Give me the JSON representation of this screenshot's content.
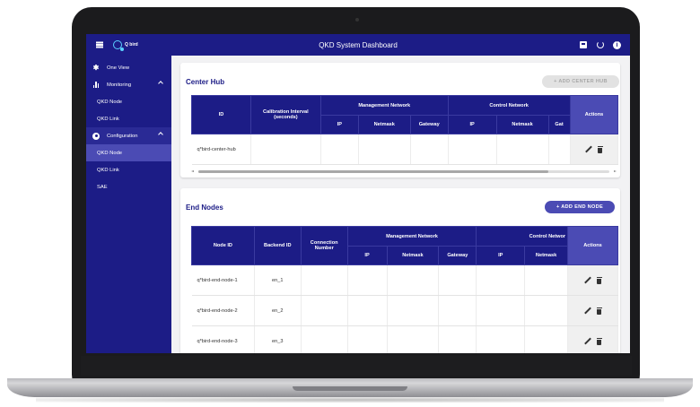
{
  "appbar": {
    "title": "QKD System Dashboard",
    "logo_text": "Q bird"
  },
  "sidebar": {
    "items": [
      {
        "label": "One View",
        "icon": "asterisk-icon"
      },
      {
        "label": "Monitoring",
        "icon": "bar-chart-icon"
      },
      {
        "label": "QKD Node"
      },
      {
        "label": "QKD Link"
      },
      {
        "label": "Configuration",
        "icon": "gear-icon"
      },
      {
        "label": "QKD Node",
        "active": true
      },
      {
        "label": "QKD Link"
      },
      {
        "label": "SAE"
      }
    ]
  },
  "center_hub": {
    "title": "Center Hub",
    "add_button": "+ ADD CENTER HUB",
    "headers": {
      "id": "ID",
      "calibration": "Calibration Interval (seconds)",
      "mgmt": "Management Network",
      "control": "Control Network",
      "actions": "Actions",
      "ip": "IP",
      "netmask": "Netmask",
      "gateway": "Gateway",
      "gateway_cut": "Gat"
    },
    "rows": [
      {
        "id": "q*bird-center-hub"
      }
    ]
  },
  "end_nodes": {
    "title": "End Nodes",
    "add_button": "+ ADD END NODE",
    "headers": {
      "node_id": "Node ID",
      "backend_id": "Backend ID",
      "conn_number": "Connection Number",
      "mgmt": "Management Network",
      "control": "Control Networ",
      "actions": "Actions",
      "ip": "IP",
      "netmask": "Netmask",
      "gateway": "Gateway"
    },
    "rows": [
      {
        "node_id": "q*bird-end-node-1",
        "backend_id": "en_1"
      },
      {
        "node_id": "q*bird-end-node-2",
        "backend_id": "en_2"
      },
      {
        "node_id": "q*bird-end-node-3",
        "backend_id": "en_3"
      }
    ]
  },
  "colors": {
    "primary": "#1c1c86",
    "accent": "#4b4bb4"
  }
}
